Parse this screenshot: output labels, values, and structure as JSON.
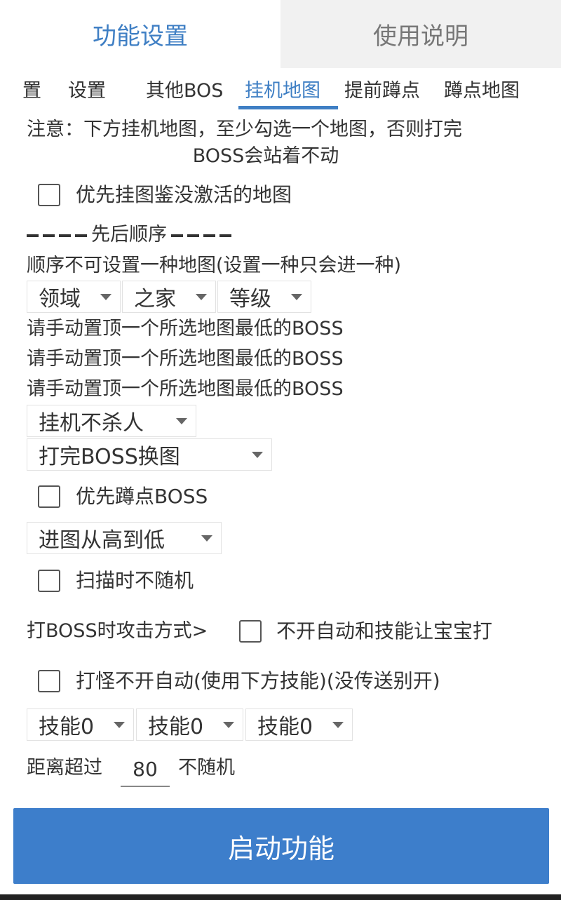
{
  "tabs": {
    "func_label": "功能设置",
    "help_label": "使用说明"
  },
  "subtabs": [
    {
      "label": "置"
    },
    {
      "label": "设置"
    },
    {
      "label": "其他BOS"
    },
    {
      "label": "挂机地图",
      "active": true
    },
    {
      "label": "提前蹲点"
    },
    {
      "label": "蹲点地图"
    }
  ],
  "notice": {
    "line1": "注意：下方挂机地图，至少勾选一个地图，否则打完",
    "line2": "BOSS会站着不动"
  },
  "options": {
    "prefer_inactive_map": {
      "label": "优先挂图鉴没激活的地图",
      "checked": false
    },
    "order_divider": "先后顺序",
    "order_hint": "顺序不可设置一种地图(设置一种只会进一种)",
    "order_dropdowns": [
      "领域",
      "之家",
      "等级"
    ],
    "pin_hints": [
      "请手动置顶一个所选地图最低的BOSS",
      "请手动置顶一个所选地图最低的BOSS",
      "请手动置顶一个所选地图最低的BOSS"
    ],
    "kill_mode": "挂机不杀人",
    "after_boss": "打完BOSS换图",
    "prefer_camp_boss": {
      "label": "优先蹲点BOSS",
      "checked": false
    },
    "map_order": "进图从高到低",
    "scan_no_random": {
      "label": "扫描时不随机",
      "checked": false
    },
    "boss_attack_label": "打BOSS时攻击方式>",
    "boss_attack_option": {
      "label": "不开自动和技能让宝宝打",
      "checked": false
    },
    "monster_no_auto": {
      "label": "打怪不开自动(使用下方技能)(没传送别开)",
      "checked": false
    },
    "skills": [
      "技能0",
      "技能0",
      "技能0"
    ],
    "distance_prefix": "距离超过",
    "distance_value": "80",
    "distance_suffix": "不随机"
  },
  "start_button_label": "启动功能",
  "colors": {
    "accent": "#3f7fc4",
    "button": "#3d7ecb"
  }
}
